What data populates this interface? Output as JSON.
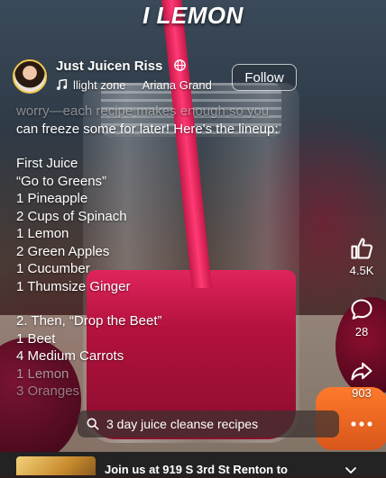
{
  "video": {
    "top_title": "I LEMON"
  },
  "header": {
    "username": "Just Juicen Riss",
    "music_track": "llight zone",
    "music_artist": "Ariana Grand",
    "follow_label": "Follow"
  },
  "caption": {
    "faded_line_1": "worry—each recipe makes enough so you",
    "faded_line_2": "can freeze some for later! Here's the lineup:",
    "section_1_title": "First Juice",
    "section_1_subtitle": "“Go to Greens”",
    "section_1_items": [
      "1 Pineapple",
      "2 Cups of Spinach",
      "1 Lemon",
      "2 Green Apples",
      "1 Cucumber",
      "1 Thumsize Ginger"
    ],
    "section_2_title": "2. Then, “Drop the Beet”",
    "section_2_items": [
      "1 Beet",
      "4 Medium Carrots",
      "1 Lemon",
      "3 Oranges"
    ]
  },
  "actions": {
    "likes": "4.5K",
    "comments": "28",
    "shares": "903"
  },
  "search": {
    "query": "3 day juice cleanse recipes"
  },
  "promo": {
    "text": "Join us at 919 S 3rd St Renton to"
  },
  "colors": {
    "juice": "#b3123d",
    "avatar_ring": "#f2c94c"
  },
  "icons": [
    "globe-icon",
    "music-note-icon",
    "heart-like-icon",
    "comment-bubble-icon",
    "share-arrow-icon",
    "search-icon",
    "more-dots-icon",
    "close-icon"
  ]
}
